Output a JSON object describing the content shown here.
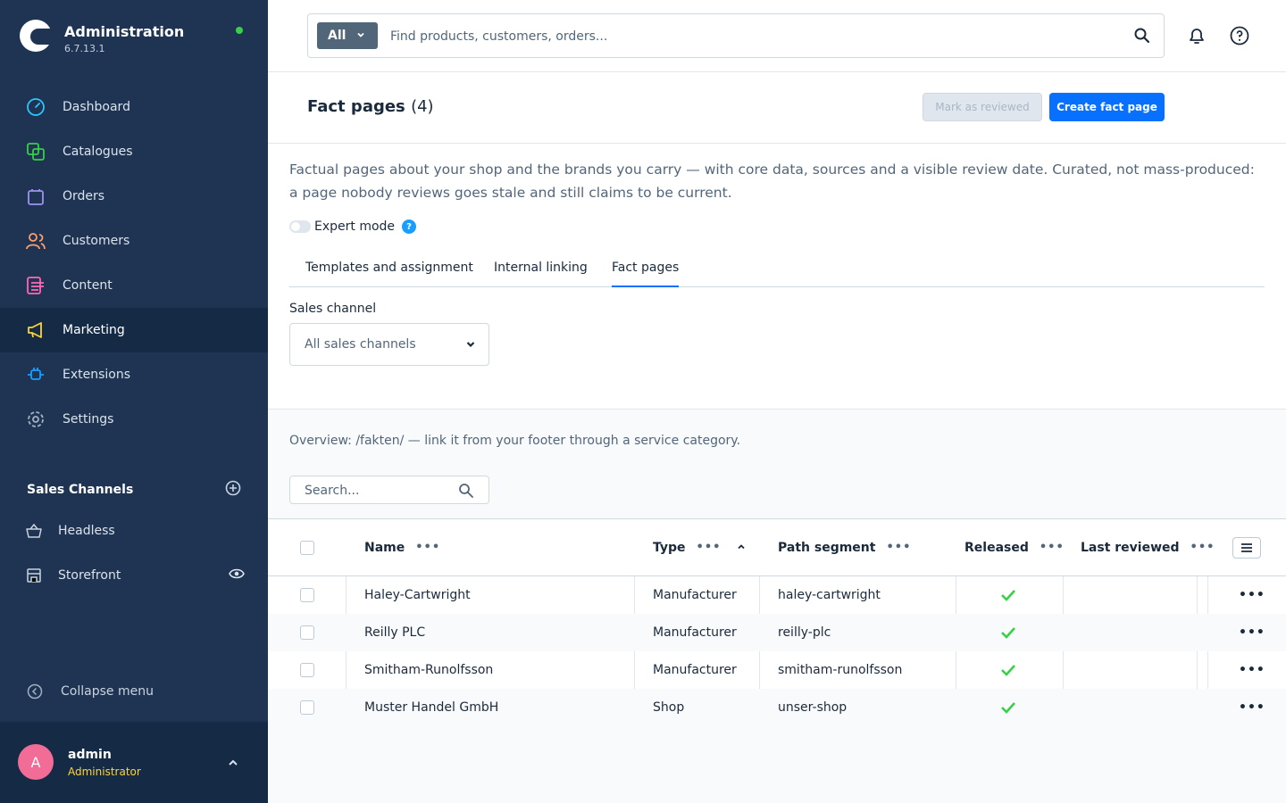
{
  "app": {
    "title": "Administration",
    "version": "6.7.13.1"
  },
  "nav": {
    "items": [
      {
        "label": "Dashboard",
        "icon": "gauge-icon"
      },
      {
        "label": "Catalogues",
        "icon": "catalog-icon"
      },
      {
        "label": "Orders",
        "icon": "bag-icon"
      },
      {
        "label": "Customers",
        "icon": "users-icon"
      },
      {
        "label": "Content",
        "icon": "content-icon"
      },
      {
        "label": "Marketing",
        "icon": "megaphone-icon",
        "active": true
      },
      {
        "label": "Extensions",
        "icon": "plug-icon"
      },
      {
        "label": "Settings",
        "icon": "gear-icon"
      }
    ],
    "sales_channels_title": "Sales Channels",
    "sales_channels": [
      {
        "label": "Headless"
      },
      {
        "label": "Storefront"
      }
    ],
    "collapse_label": "Collapse menu"
  },
  "user": {
    "initial": "A",
    "name": "admin",
    "role": "Administrator"
  },
  "search": {
    "type_label": "All",
    "placeholder": "Find products, customers, orders..."
  },
  "page": {
    "title": "Fact pages",
    "count": "(4)",
    "btn_review": "Mark as reviewed",
    "btn_create": "Create fact page",
    "intro": "Factual pages about your shop and the brands you carry — with core data, sources and a visible review date. Curated, not mass-produced: a page nobody reviews goes stale and still claims to be current.",
    "expert_mode": "Expert mode",
    "tabs": [
      "Templates and assignment",
      "Internal linking",
      "Fact pages"
    ],
    "active_tab": "Fact pages",
    "sales_channel_label": "Sales channel",
    "sales_channel_value": "All sales channels",
    "overview": "Overview: /fakten/ — link it from your footer through a service category.",
    "list_search_placeholder": "Search..."
  },
  "grid": {
    "columns": [
      "Name",
      "Type",
      "Path segment",
      "Released",
      "Last reviewed"
    ],
    "rows": [
      {
        "name": "Haley-Cartwright",
        "type": "Manufacturer",
        "path": "haley-cartwright",
        "released": true,
        "last_reviewed": ""
      },
      {
        "name": "Reilly PLC",
        "type": "Manufacturer",
        "path": "reilly-plc",
        "released": true,
        "last_reviewed": ""
      },
      {
        "name": "Smitham-Runolfsson",
        "type": "Manufacturer",
        "path": "smitham-runolfsson",
        "released": true,
        "last_reviewed": ""
      },
      {
        "name": "Muster Handel GmbH",
        "type": "Shop",
        "path": "unser-shop",
        "released": true,
        "last_reviewed": ""
      }
    ]
  },
  "colors": {
    "sidebar": "#1e3452",
    "accent": "#0870ff",
    "check": "#37d046",
    "avatar": "#f16c96",
    "role": "#ffd33d"
  }
}
